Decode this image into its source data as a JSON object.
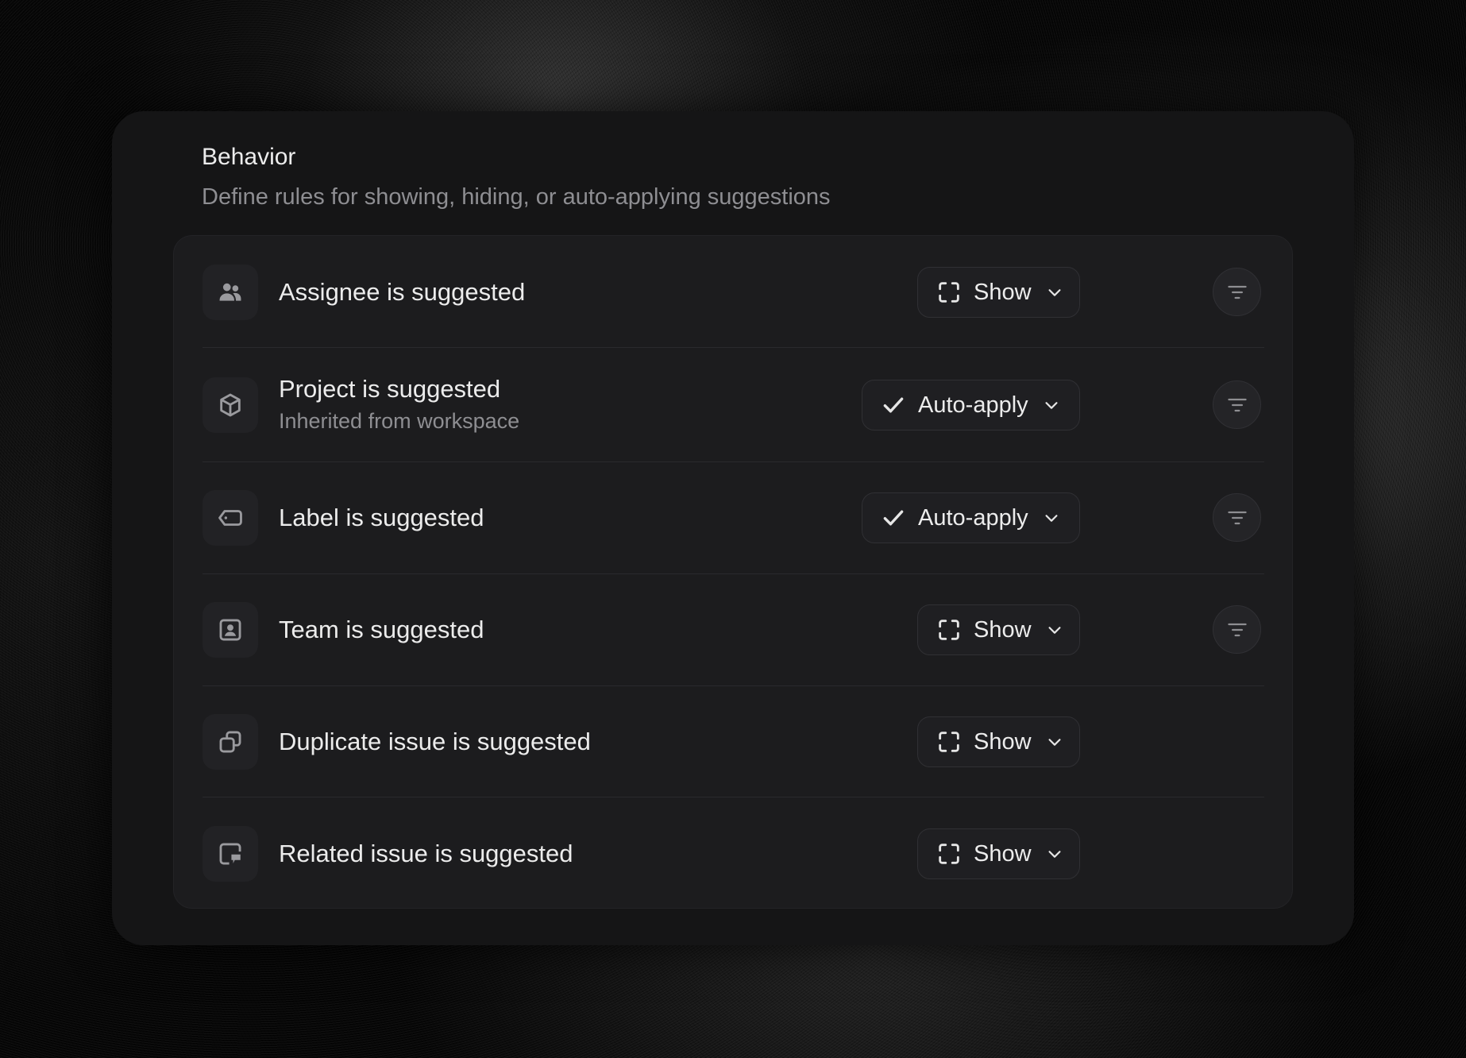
{
  "section": {
    "title": "Behavior",
    "subtitle": "Define rules for showing, hiding, or auto-applying suggestions"
  },
  "rows": [
    {
      "title": "Assignee is suggested",
      "subtitle": "",
      "icon": "users-icon",
      "action": "Show",
      "action_icon": "dashed-frame-icon",
      "has_filter": true
    },
    {
      "title": "Project is suggested",
      "subtitle": "Inherited from workspace",
      "icon": "cube-icon",
      "action": "Auto-apply",
      "action_icon": "check-icon",
      "has_filter": true
    },
    {
      "title": "Label is suggested",
      "subtitle": "",
      "icon": "tag-icon",
      "action": "Auto-apply",
      "action_icon": "check-icon",
      "has_filter": true
    },
    {
      "title": "Team is suggested",
      "subtitle": "",
      "icon": "contact-card-icon",
      "action": "Show",
      "action_icon": "dashed-frame-icon",
      "has_filter": true
    },
    {
      "title": "Duplicate issue is suggested",
      "subtitle": "",
      "icon": "duplicate-icon",
      "action": "Show",
      "action_icon": "dashed-frame-icon",
      "has_filter": false
    },
    {
      "title": "Related issue is suggested",
      "subtitle": "",
      "icon": "related-issue-icon",
      "action": "Show",
      "action_icon": "dashed-frame-icon",
      "has_filter": false
    }
  ],
  "colors": {
    "card_bg": "#151516",
    "list_bg": "#1c1c1e",
    "text_primary": "#ececec",
    "text_secondary": "#8e8e92"
  }
}
